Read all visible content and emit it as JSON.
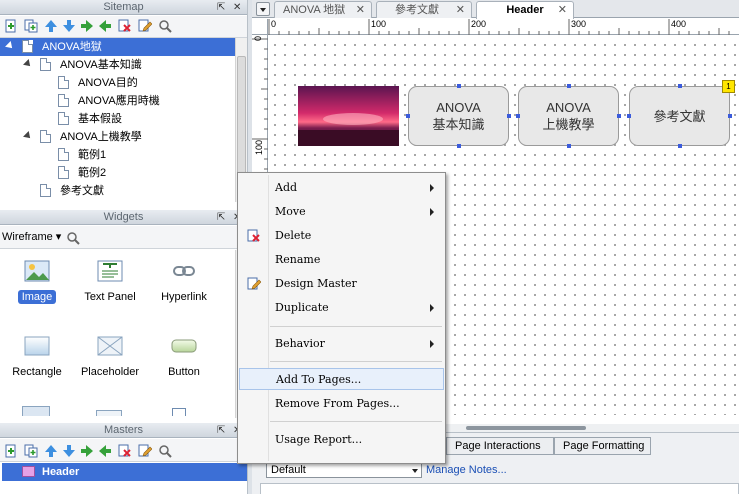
{
  "sitemap": {
    "title": "Sitemap",
    "items": [
      {
        "label": "ANOVA地獄"
      },
      {
        "label": "ANOVA基本知識"
      },
      {
        "label": "ANOVA目的"
      },
      {
        "label": "ANOVA應用時機"
      },
      {
        "label": "基本假設"
      },
      {
        "label": "ANOVA上機教學"
      },
      {
        "label": "範例1"
      },
      {
        "label": "範例2"
      },
      {
        "label": "參考文獻"
      }
    ]
  },
  "widgets": {
    "title": "Widgets",
    "library": "Wireframe",
    "items": [
      {
        "label": "Image"
      },
      {
        "label": "Text Panel"
      },
      {
        "label": "Hyperlink"
      },
      {
        "label": "Rectangle"
      },
      {
        "label": "Placeholder"
      },
      {
        "label": "Button"
      }
    ]
  },
  "masters": {
    "title": "Masters",
    "items": [
      {
        "label": "Header"
      }
    ]
  },
  "tabs": [
    {
      "label": "ANOVA 地獄"
    },
    {
      "label": "參考文獻"
    },
    {
      "label": "Header"
    }
  ],
  "ruler": {
    "h_ticks": [
      "0",
      "100",
      "200",
      "300",
      "400"
    ],
    "v_ticks": [
      "0",
      "100"
    ]
  },
  "canvas": {
    "nodes": [
      {
        "line1": "ANOVA",
        "line2": "基本知識"
      },
      {
        "line1": "ANOVA",
        "line2": "上機教學"
      },
      {
        "line1": "參考文獻",
        "line2": ""
      }
    ],
    "footnote_badge": "1"
  },
  "context_menu": {
    "items": [
      {
        "label": "Add",
        "submenu": true
      },
      {
        "label": "Move",
        "submenu": true
      },
      {
        "label": "Delete",
        "icon": "delete-icon"
      },
      {
        "label": "Rename"
      },
      {
        "label": "Design Master",
        "icon": "edit-icon"
      },
      {
        "label": "Duplicate",
        "submenu": true
      },
      {
        "label": "Behavior",
        "submenu": true
      },
      {
        "label": "Add To Pages..."
      },
      {
        "label": "Remove From Pages..."
      },
      {
        "label": "Usage Report..."
      }
    ]
  },
  "bottom": {
    "tabs": [
      {
        "label": "Page Interactions"
      },
      {
        "label": "Page Formatting"
      }
    ],
    "notes_select": "Default",
    "manage_notes": "Manage Notes..."
  },
  "colors": {
    "selection": "#3c6fd6",
    "handle": "#3b5bdb",
    "badge": "#ffe600"
  }
}
